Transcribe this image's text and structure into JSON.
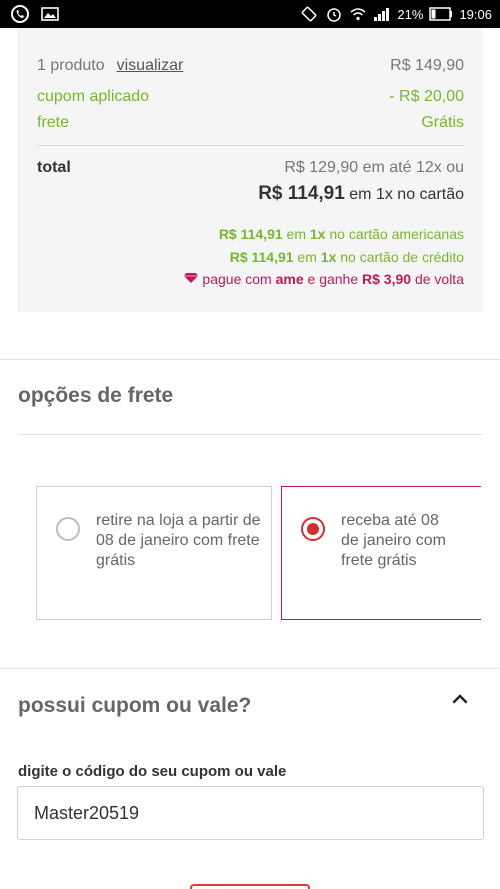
{
  "status_bar": {
    "icons_left": [
      "whatsapp-icon",
      "gallery-icon"
    ],
    "icons_right": [
      "vibrate-icon",
      "alarm-icon",
      "wifi-icon",
      "signal-icon"
    ],
    "battery": "21%",
    "time": "19:06"
  },
  "summary": {
    "product_count": "1 produto",
    "view_link": "visualizar",
    "product_price": "R$ 149,90",
    "coupon_label": "cupom aplicado",
    "coupon_value": "- R$ 20,00",
    "shipping_label": "frete",
    "shipping_value": "Grátis",
    "total_label": "total",
    "installments": "R$ 129,90 em até 12x ou",
    "cash_price": "R$ 114,91",
    "cash_suffix": " em 1x no cartão",
    "americanas_price": "R$ 114,91",
    "americanas_mid": " em ",
    "americanas_times": "1x",
    "americanas_suffix": " no cartão americanas",
    "credit_price": "R$ 114,91",
    "credit_mid": " em ",
    "credit_times": "1x",
    "credit_suffix": " no cartão de crédito",
    "ame_prefix": "pague com ",
    "ame_brand": "ame",
    "ame_mid": " e ganhe ",
    "ame_cashback": "R$ 3,90",
    "ame_suffix": " de volta",
    "colors": {
      "green": "#75b82e",
      "ame": "#c2185b"
    }
  },
  "shipping": {
    "title": "opções de frete",
    "options": [
      {
        "text": "retire na loja a partir de 08 de janeiro com frete grátis",
        "selected": false
      },
      {
        "text": "receba até 08 de janeiro com frete grátis",
        "selected": true
      }
    ]
  },
  "coupon": {
    "title": "possui cupom ou vale?",
    "field_label": "digite o código do seu cupom ou vale",
    "field_value": "Master20519",
    "accent": "#e53935"
  }
}
